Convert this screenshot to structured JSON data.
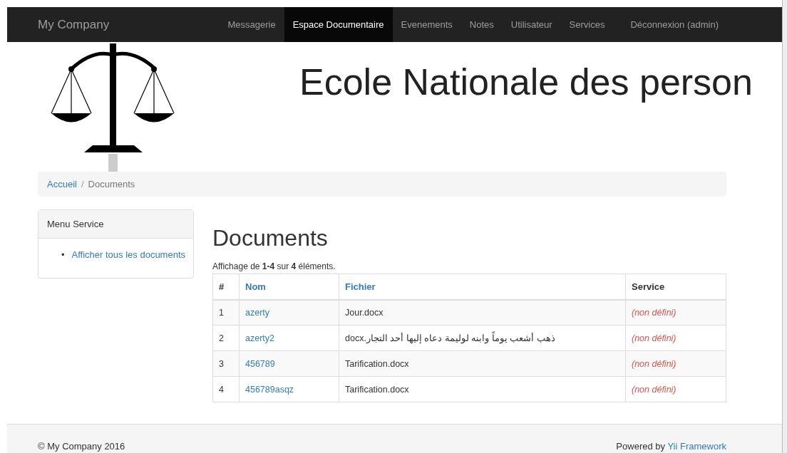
{
  "navbar": {
    "brand": "My Company",
    "items": [
      {
        "label": "Messagerie",
        "selected": false
      },
      {
        "label": "Espace Documentaire",
        "selected": true
      },
      {
        "label": "Evenements",
        "selected": false
      },
      {
        "label": "Notes",
        "selected": false
      },
      {
        "label": "Utilisateur",
        "selected": false
      },
      {
        "label": "Services",
        "selected": false
      }
    ],
    "logout": "Déconnexion (admin)"
  },
  "header": {
    "title": "Ecole Nationale des person"
  },
  "breadcrumb": {
    "separator": "/",
    "items": [
      "Accueil",
      "Documents"
    ]
  },
  "sidebar": {
    "title": "Menu Service",
    "bullet": "•",
    "items": [
      "Afficher tous les documents"
    ]
  },
  "main": {
    "title": "Documents",
    "summary": "Affichage de **1-4** sur **4** éléments.",
    "table": {
      "columns": [
        {
          "label": "#",
          "link": false
        },
        {
          "label": "Nom",
          "link": true
        },
        {
          "label": "Fichier",
          "link": true
        },
        {
          "label": "Service",
          "link": false
        }
      ],
      "rows": [
        [
          "1",
          "azerty",
          "Jour.docx",
          "(non défini)"
        ],
        [
          "2",
          "azerty2",
          "ذهب أشعب يوماً وابنه لوليمة دعاه إليها أحد التجار.docx",
          "(non défini)"
        ],
        [
          "3",
          "456789",
          "Tarification.docx",
          "(non défini)"
        ],
        [
          "4",
          "456789asqz",
          "Tarification.docx",
          "(non défini)"
        ]
      ]
    }
  },
  "footer": {
    "copyright": "© My Company 2016",
    "powered": "Powered by",
    "link": "Yii Framework"
  }
}
